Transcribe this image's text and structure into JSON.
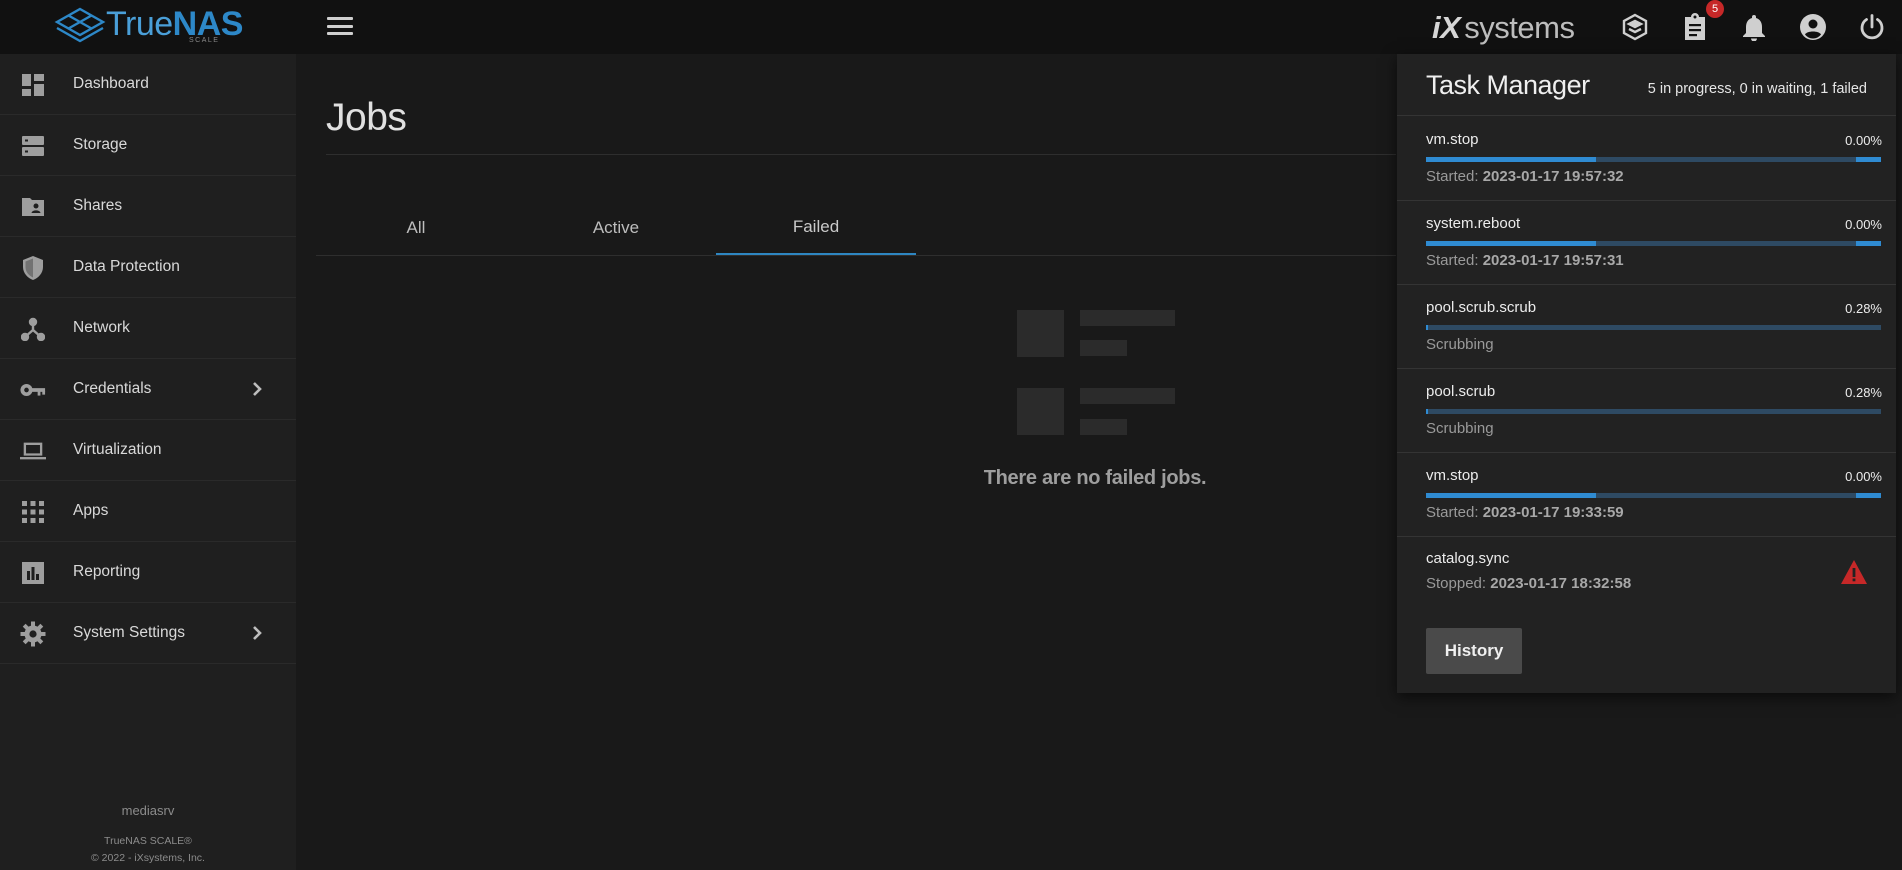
{
  "header": {
    "brand": "TrueNAS",
    "brand_true": "True",
    "brand_nas": "NAS",
    "brand_sub": "SCALE",
    "vendor_ix": "iX",
    "vendor_rest": "systems",
    "tasks_badge": "5",
    "icons": [
      "menu-icon",
      "truecommand-icon",
      "clipboard-icon",
      "bell-icon",
      "account-icon",
      "power-icon"
    ]
  },
  "sidebar": {
    "items": [
      {
        "label": "Dashboard",
        "icon": "dashboard-icon"
      },
      {
        "label": "Storage",
        "icon": "storage-icon"
      },
      {
        "label": "Shares",
        "icon": "folder-shared-icon"
      },
      {
        "label": "Data Protection",
        "icon": "shield-icon"
      },
      {
        "label": "Network",
        "icon": "network-icon"
      },
      {
        "label": "Credentials",
        "icon": "key-icon",
        "has_submenu": true
      },
      {
        "label": "Virtualization",
        "icon": "laptop-icon"
      },
      {
        "label": "Apps",
        "icon": "apps-grid-icon"
      },
      {
        "label": "Reporting",
        "icon": "bar-chart-icon"
      },
      {
        "label": "System Settings",
        "icon": "gear-icon",
        "has_submenu": true
      }
    ],
    "hostname": "mediasrv",
    "product": "TrueNAS SCALE®",
    "copyright": "© 2022 - iXsystems, Inc."
  },
  "main": {
    "title": "Jobs",
    "tabs": [
      {
        "label": "All",
        "active": false
      },
      {
        "label": "Active",
        "active": false
      },
      {
        "label": "Failed",
        "active": true
      }
    ],
    "empty_message": "There are no failed jobs."
  },
  "task_manager": {
    "title": "Task Manager",
    "summary": "5 in progress, 0 in waiting, 1 failed",
    "jobs": [
      {
        "name": "vm.stop",
        "percent": "0.00%",
        "status_label": "Started:",
        "status_value": "2023-01-17 19:57:32",
        "progress": 0.0
      },
      {
        "name": "system.reboot",
        "percent": "0.00%",
        "status_label": "Started:",
        "status_value": "2023-01-17 19:57:31",
        "progress": 0.0
      },
      {
        "name": "pool.scrub.scrub",
        "percent": "0.28%",
        "status_label": "Scrubbing",
        "status_value": "",
        "progress": 0.0028
      },
      {
        "name": "pool.scrub",
        "percent": "0.28%",
        "status_label": "Scrubbing",
        "status_value": "",
        "progress": 0.0028
      },
      {
        "name": "vm.stop",
        "percent": "0.00%",
        "status_label": "Started:",
        "status_value": "2023-01-17 19:33:59",
        "progress": 0.0
      },
      {
        "name": "catalog.sync",
        "percent": "",
        "status_label": "Stopped:",
        "status_value": "2023-01-17 18:32:58",
        "failed": true
      }
    ],
    "history_label": "History"
  },
  "colors": {
    "accent": "#2f8bd2",
    "brand": "#2d88c8",
    "error": "#c62828",
    "badge": "#c62828"
  }
}
